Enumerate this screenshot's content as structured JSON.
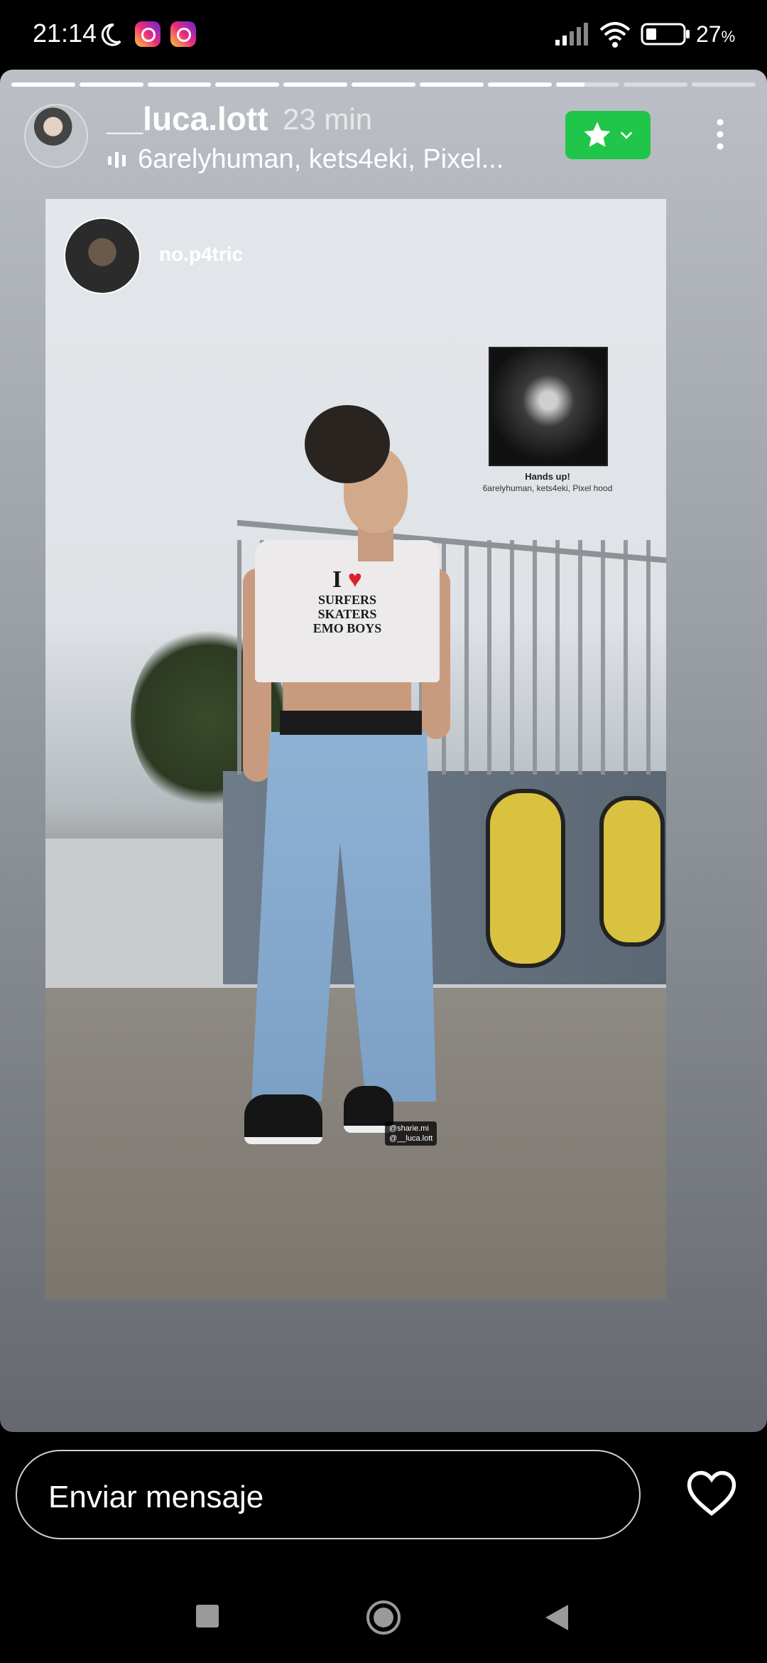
{
  "status_bar": {
    "time": "21:14",
    "battery_percent": "27",
    "battery_unit": "%",
    "icons": [
      "moon-icon",
      "instagram-icon",
      "instagram-icon",
      "signal-icon",
      "wifi-icon",
      "battery-icon"
    ]
  },
  "story": {
    "progress_segments": [
      1,
      1,
      1,
      1,
      1,
      1,
      1,
      1,
      0.45,
      0,
      0
    ],
    "username": "__luca.lott",
    "time_ago": "23 min",
    "music_label": "6arelyhuman, kets4eki, Pixel...",
    "close_friends_color": "#1fc64a",
    "content": {
      "reposted_username": "no.p4tric",
      "music_sticker_title": "Hands up!",
      "music_sticker_artists": "6arelyhuman, kets4eki, Pixel hood",
      "tag_line_1": "@sharie.mi",
      "tag_line_2": "@__luca.lott",
      "shirt_line_1": "I",
      "shirt_line_2": "SURFERS",
      "shirt_line_3": "SKATERS",
      "shirt_line_4": "EMO BOYS"
    }
  },
  "bottom_bar": {
    "message_placeholder": "Enviar mensaje"
  },
  "nav": {
    "buttons": [
      "recents-icon",
      "home-icon",
      "back-icon"
    ]
  }
}
